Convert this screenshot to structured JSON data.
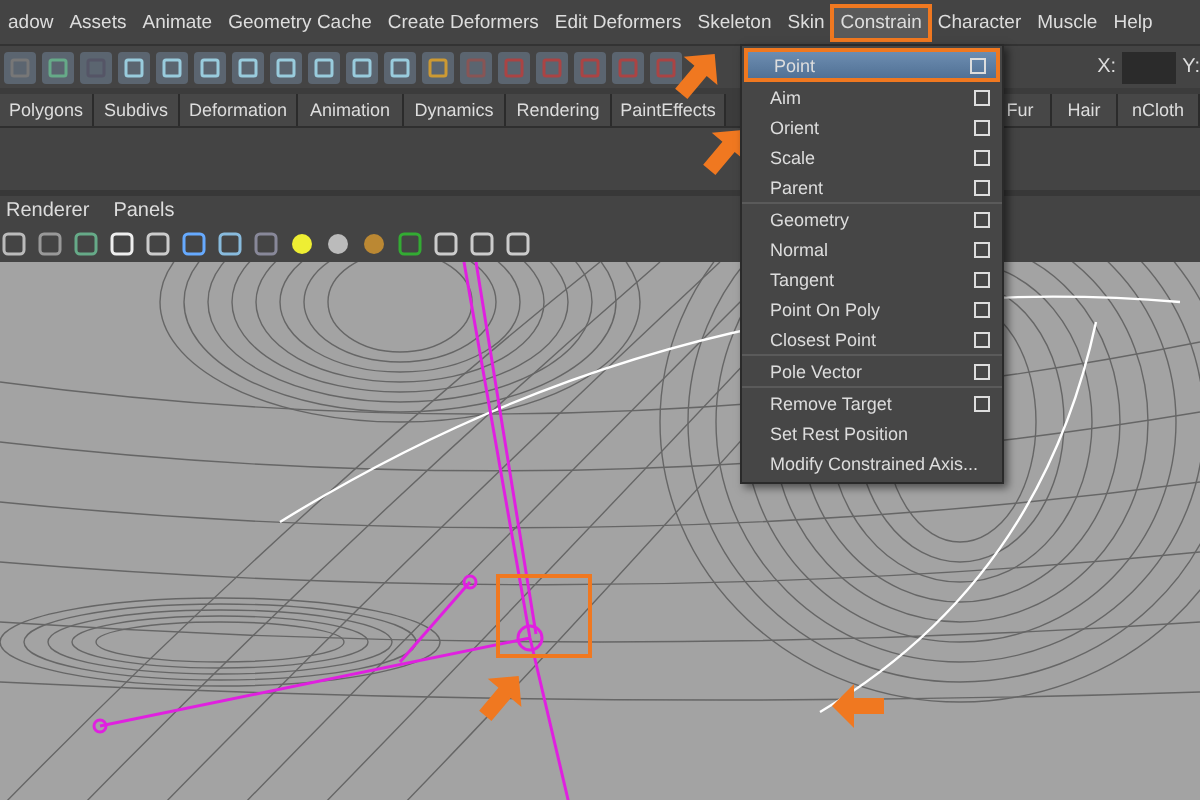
{
  "menubar": [
    {
      "label": "adow",
      "selected": false
    },
    {
      "label": "Assets",
      "selected": false
    },
    {
      "label": "Animate",
      "selected": false
    },
    {
      "label": "Geometry Cache",
      "selected": false
    },
    {
      "label": "Create Deformers",
      "selected": false
    },
    {
      "label": "Edit Deformers",
      "selected": false
    },
    {
      "label": "Skeleton",
      "selected": false
    },
    {
      "label": "Skin",
      "selected": false
    },
    {
      "label": "Constrain",
      "selected": true
    },
    {
      "label": "Character",
      "selected": false
    },
    {
      "label": "Muscle",
      "selected": false
    },
    {
      "label": "Help",
      "selected": false
    }
  ],
  "toolbar": {
    "x_label": "X:",
    "y_label": "Y:"
  },
  "shelf_tabs_left": [
    "Polygons",
    "Subdivs",
    "Deformation",
    "Animation",
    "Dynamics",
    "Rendering",
    "PaintEffects"
  ],
  "shelf_tabs_right": [
    "Fur",
    "Hair",
    "nCloth"
  ],
  "panel_menu": [
    "Renderer",
    "Panels"
  ],
  "dropdown": {
    "groups": [
      [
        {
          "label": "Point",
          "option": true,
          "selected": true
        },
        {
          "label": "Aim",
          "option": true,
          "selected": false
        },
        {
          "label": "Orient",
          "option": true,
          "selected": false
        },
        {
          "label": "Scale",
          "option": true,
          "selected": false
        },
        {
          "label": "Parent",
          "option": true,
          "selected": false
        }
      ],
      [
        {
          "label": "Geometry",
          "option": true,
          "selected": false
        },
        {
          "label": "Normal",
          "option": true,
          "selected": false
        },
        {
          "label": "Tangent",
          "option": true,
          "selected": false
        },
        {
          "label": "Point On Poly",
          "option": true,
          "selected": false
        },
        {
          "label": "Closest Point",
          "option": true,
          "selected": false
        }
      ],
      [
        {
          "label": "Pole Vector",
          "option": true,
          "selected": false
        }
      ],
      [
        {
          "label": "Remove Target",
          "option": true,
          "selected": false
        },
        {
          "label": "Set Rest Position",
          "option": false,
          "selected": false
        },
        {
          "label": "Modify Constrained Axis...",
          "option": false,
          "selected": false
        }
      ]
    ]
  }
}
